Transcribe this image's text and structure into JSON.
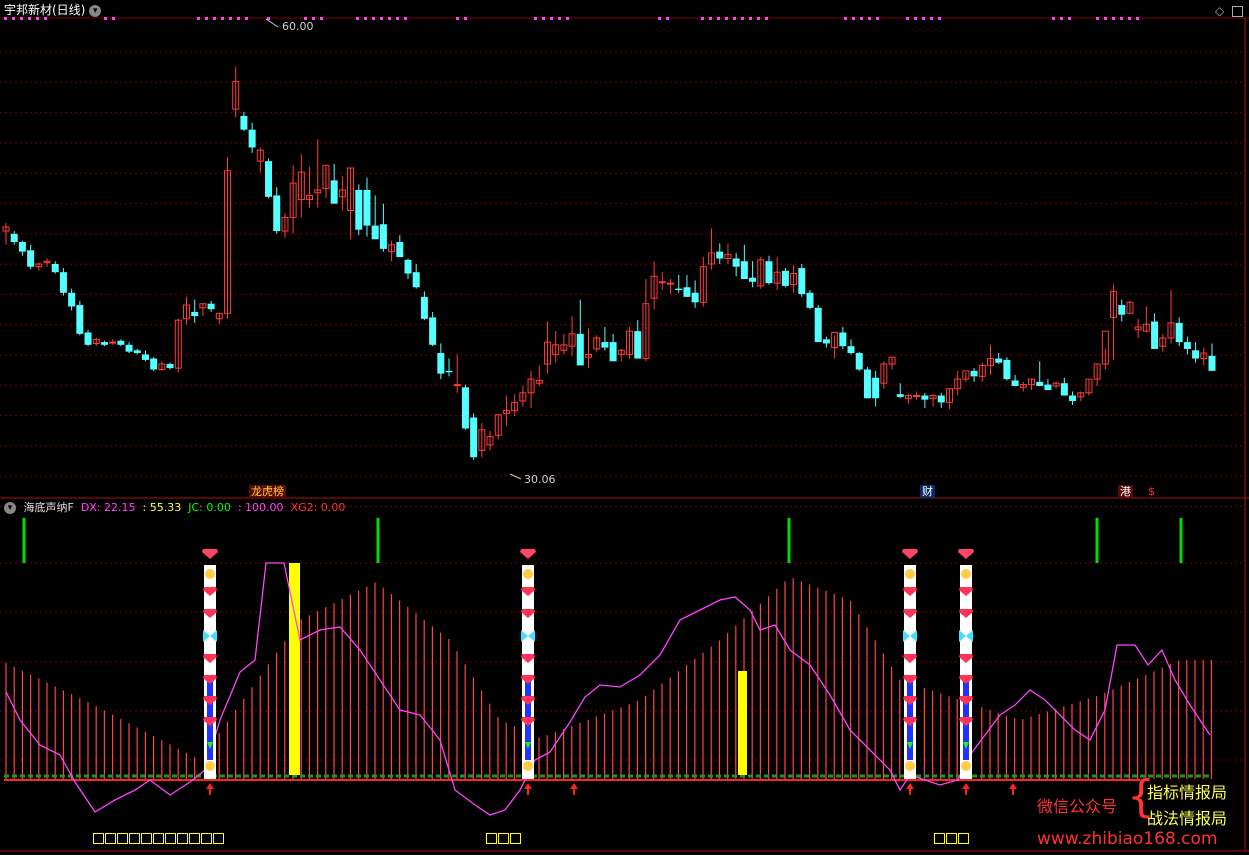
{
  "window": {
    "title": "宇邦新材(日线)",
    "corner_icon": "diamond-icon",
    "max_icon": "window-icon"
  },
  "price_chart": {
    "high_label": "60.00",
    "low_label": "30.06",
    "up_color": "#ff3b3b",
    "down_color": "#54ffff",
    "grid_color": "#7a0000",
    "event_tags": {
      "longhu": "龙虎榜",
      "cai": "财",
      "gang": "港",
      "s": "$"
    }
  },
  "indicator": {
    "name": "海底声纳F",
    "dx_label": "DX: 22.15",
    "sep_value": ": 55.33",
    "jc_label": "JC: 0.00",
    "val100": ": 100.00",
    "xg2_label": "XG2: 0.00",
    "colors": {
      "dx": "#ff44ff",
      "jc": "#00ff00",
      "xg2": "#ff3333",
      "bars": "#ff4444",
      "line": "#ff44ff"
    }
  },
  "watermark": {
    "wechat": "微信公众号",
    "name1": "指标情报局",
    "name2": "战法情报局",
    "url": "www.zhibiao168.com"
  },
  "chart_data": {
    "type": "candlestick",
    "title": "宇邦新材(日线)",
    "ylim": [
      28,
      62
    ],
    "candles": [
      [
        46.6,
        47.2,
        45.6,
        46.9
      ],
      [
        46.4,
        46.6,
        45.6,
        45.8
      ],
      [
        45.8,
        45.9,
        44.8,
        45.1
      ],
      [
        45.2,
        45.6,
        43.8,
        44.0
      ],
      [
        44.0,
        44.3,
        43.7,
        44.2
      ],
      [
        44.3,
        44.6,
        44.0,
        44.4
      ],
      [
        44.2,
        44.4,
        43.5,
        43.6
      ],
      [
        43.6,
        43.9,
        41.9,
        42.1
      ],
      [
        42.1,
        42.4,
        40.8,
        41.1
      ],
      [
        41.2,
        41.5,
        39.0,
        39.1
      ],
      [
        39.2,
        39.4,
        38.2,
        38.3
      ],
      [
        38.4,
        38.8,
        38.2,
        38.7
      ],
      [
        38.5,
        38.6,
        38.2,
        38.3
      ],
      [
        38.5,
        38.7,
        38.3,
        38.5
      ],
      [
        38.6,
        38.7,
        38.2,
        38.3
      ],
      [
        38.3,
        38.5,
        37.7,
        37.8
      ],
      [
        37.9,
        38.0,
        37.6,
        37.7
      ],
      [
        37.6,
        37.9,
        37.1,
        37.2
      ],
      [
        37.3,
        37.4,
        36.4,
        36.5
      ],
      [
        36.5,
        37.1,
        36.4,
        36.9
      ],
      [
        36.9,
        37.0,
        36.5,
        36.6
      ],
      [
        36.6,
        40.2,
        36.3,
        40.1
      ],
      [
        40.2,
        41.8,
        39.8,
        41.2
      ],
      [
        40.7,
        41.6,
        39.9,
        40.4
      ],
      [
        41.0,
        41.3,
        40.4,
        41.3
      ],
      [
        41.3,
        41.5,
        40.7,
        40.9
      ],
      [
        40.2,
        40.6,
        39.8,
        40.6
      ],
      [
        40.6,
        52.0,
        40.2,
        51.0
      ],
      [
        55.5,
        58.6,
        54.9,
        57.5
      ],
      [
        55.0,
        55.3,
        53.9,
        54.0
      ],
      [
        54.0,
        54.5,
        52.3,
        52.7
      ],
      [
        51.7,
        52.7,
        50.9,
        52.5
      ],
      [
        51.7,
        51.9,
        49.0,
        49.1
      ],
      [
        49.2,
        49.8,
        46.4,
        46.6
      ],
      [
        46.6,
        47.9,
        46.1,
        47.6
      ],
      [
        47.6,
        51.4,
        46.4,
        50.1
      ],
      [
        48.9,
        52.2,
        47.6,
        50.9
      ],
      [
        48.9,
        51.3,
        48.3,
        49.2
      ],
      [
        49.4,
        53.3,
        48.3,
        49.6
      ],
      [
        49.7,
        51.4,
        49.0,
        51.4
      ],
      [
        50.3,
        51.5,
        48.6,
        48.6
      ],
      [
        49.1,
        50.6,
        48.1,
        49.6
      ],
      [
        48.1,
        51.2,
        46.0,
        51.2
      ],
      [
        49.6,
        50.0,
        46.3,
        46.7
      ],
      [
        49.6,
        50.5,
        46.2,
        47.0
      ],
      [
        47.0,
        49.2,
        46.2,
        46.0
      ],
      [
        47.1,
        48.6,
        45.1,
        45.3
      ],
      [
        45.1,
        45.9,
        44.4,
        45.6
      ],
      [
        45.8,
        46.3,
        44.7,
        44.7
      ],
      [
        44.5,
        44.6,
        43.1,
        43.5
      ],
      [
        43.6,
        44.2,
        42.4,
        42.5
      ],
      [
        41.8,
        42.2,
        40.1,
        40.2
      ],
      [
        40.3,
        40.7,
        38.2,
        38.3
      ],
      [
        37.7,
        38.4,
        35.8,
        36.2
      ],
      [
        36.4,
        37.3,
        36.0,
        36.3
      ],
      [
        35.4,
        37.6,
        34.8,
        35.4
      ],
      [
        35.2,
        35.4,
        32.1,
        32.2
      ],
      [
        33.0,
        33.3,
        29.9,
        30.1
      ],
      [
        30.6,
        32.6,
        30.1,
        32.1
      ],
      [
        31.0,
        32.0,
        30.6,
        31.6
      ],
      [
        31.7,
        33.2,
        31.4,
        33.2
      ],
      [
        33.3,
        34.6,
        32.4,
        33.5
      ],
      [
        33.5,
        34.7,
        33.1,
        34.1
      ],
      [
        34.2,
        35.3,
        33.8,
        34.8
      ],
      [
        34.8,
        36.4,
        33.7,
        35.8
      ],
      [
        35.5,
        36.8,
        35.3,
        35.7
      ],
      [
        36.9,
        40.0,
        36.2,
        38.5
      ],
      [
        37.6,
        39.3,
        37.0,
        38.3
      ],
      [
        37.9,
        39.1,
        37.6,
        38.3
      ],
      [
        38.2,
        40.4,
        37.5,
        39.1
      ],
      [
        39.1,
        41.6,
        37.7,
        36.8
      ],
      [
        37.4,
        39.5,
        36.6,
        37.6
      ],
      [
        38.0,
        39.0,
        37.8,
        38.8
      ],
      [
        38.5,
        39.6,
        37.9,
        38.1
      ],
      [
        38.5,
        39.1,
        37.3,
        37.1
      ],
      [
        37.6,
        38.0,
        37.1,
        37.9
      ],
      [
        37.6,
        39.6,
        37.3,
        39.3
      ],
      [
        39.3,
        40.1,
        37.4,
        37.3
      ],
      [
        37.3,
        43.1,
        37.1,
        41.3
      ],
      [
        41.7,
        44.4,
        40.9,
        43.3
      ],
      [
        42.9,
        43.6,
        42.3,
        42.9
      ],
      [
        42.8,
        43.1,
        42.0,
        42.8
      ],
      [
        42.4,
        43.4,
        42.1,
        42.3
      ],
      [
        42.5,
        43.4,
        41.8,
        41.8
      ],
      [
        42.1,
        43.0,
        41.0,
        41.4
      ],
      [
        41.4,
        44.7,
        41.1,
        44.0
      ],
      [
        44.2,
        46.8,
        43.8,
        45.0
      ],
      [
        45.1,
        45.7,
        44.2,
        44.6
      ],
      [
        44.6,
        45.7,
        44.2,
        44.9
      ],
      [
        44.6,
        45.0,
        43.3,
        44.0
      ],
      [
        44.4,
        45.6,
        43.6,
        43.1
      ],
      [
        43.2,
        44.4,
        42.5,
        42.9
      ],
      [
        42.6,
        44.7,
        42.4,
        44.5
      ],
      [
        44.4,
        44.8,
        42.7,
        42.8
      ],
      [
        42.8,
        44.7,
        42.3,
        43.6
      ],
      [
        43.7,
        43.9,
        42.5,
        42.6
      ],
      [
        42.7,
        44.1,
        42.1,
        43.5
      ],
      [
        43.9,
        44.2,
        41.8,
        42.0
      ],
      [
        42.1,
        42.3,
        40.9,
        41.0
      ],
      [
        41.0,
        41.2,
        38.5,
        38.5
      ],
      [
        38.7,
        38.9,
        38.1,
        38.4
      ],
      [
        38.1,
        39.0,
        37.3,
        39.2
      ],
      [
        39.2,
        39.6,
        38.0,
        38.2
      ],
      [
        38.2,
        38.7,
        37.6,
        37.7
      ],
      [
        37.7,
        37.8,
        36.4,
        36.5
      ],
      [
        36.5,
        36.7,
        34.4,
        34.4
      ],
      [
        35.9,
        36.4,
        33.8,
        34.4
      ],
      [
        35.5,
        37.1,
        35.1,
        36.9
      ],
      [
        36.9,
        37.4,
        36.5,
        37.4
      ],
      [
        34.7,
        35.5,
        34.4,
        34.5
      ],
      [
        34.4,
        34.7,
        34.0,
        34.6
      ],
      [
        34.6,
        34.9,
        34.3,
        34.6
      ],
      [
        34.6,
        34.8,
        33.7,
        34.3
      ],
      [
        34.4,
        34.7,
        33.8,
        34.6
      ],
      [
        34.6,
        34.8,
        33.7,
        34.1
      ],
      [
        34.1,
        35.1,
        33.6,
        35.1
      ],
      [
        35.1,
        36.4,
        34.6,
        35.8
      ],
      [
        35.8,
        36.3,
        35.6,
        36.4
      ],
      [
        36.4,
        36.6,
        35.6,
        36.0
      ],
      [
        36.0,
        37.0,
        35.6,
        36.8
      ],
      [
        36.8,
        38.3,
        36.1,
        37.3
      ],
      [
        37.3,
        37.7,
        36.9,
        37.0
      ],
      [
        37.2,
        37.4,
        35.7,
        35.8
      ],
      [
        35.7,
        36.1,
        35.3,
        35.3
      ],
      [
        35.2,
        35.6,
        34.9,
        35.4
      ],
      [
        35.4,
        35.8,
        35.0,
        35.8
      ],
      [
        35.6,
        37.1,
        35.6,
        35.3
      ],
      [
        35.4,
        35.8,
        35.0,
        35.0
      ],
      [
        35.3,
        35.6,
        35.1,
        35.5
      ],
      [
        35.5,
        35.9,
        34.6,
        34.6
      ],
      [
        34.6,
        34.9,
        33.9,
        34.2
      ],
      [
        34.5,
        34.9,
        34.2,
        34.8
      ],
      [
        34.8,
        35.8,
        34.6,
        35.8
      ],
      [
        35.8,
        36.9,
        35.3,
        36.9
      ],
      [
        36.9,
        38.0,
        36.5,
        39.3
      ],
      [
        40.3,
        42.7,
        37.2,
        42.2
      ],
      [
        41.2,
        41.6,
        40.0,
        40.5
      ],
      [
        40.6,
        41.5,
        40.6,
        41.4
      ],
      [
        39.4,
        40.2,
        38.8,
        39.6
      ],
      [
        39.3,
        41.1,
        39.2,
        39.8
      ],
      [
        40.0,
        40.6,
        38.8,
        38.0
      ],
      [
        38.2,
        39.1,
        37.8,
        38.8
      ],
      [
        38.8,
        42.3,
        38.4,
        39.9
      ],
      [
        39.9,
        40.3,
        38.2,
        38.5
      ],
      [
        38.5,
        38.9,
        37.6,
        38.0
      ],
      [
        37.9,
        38.5,
        37.0,
        37.3
      ],
      [
        37.3,
        38.1,
        36.8,
        37.7
      ],
      [
        37.5,
        38.4,
        36.9,
        36.4
      ]
    ]
  }
}
